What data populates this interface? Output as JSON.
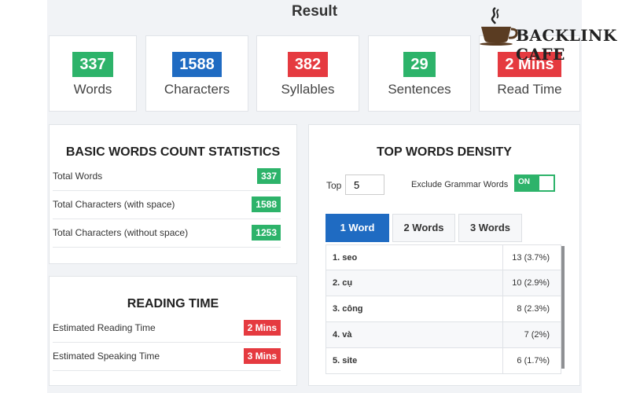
{
  "result_title": "Result",
  "stats": [
    {
      "value": "337",
      "label": "Words",
      "color": "#2db36a"
    },
    {
      "value": "1588",
      "label": "Characters",
      "color": "#1f6bc2"
    },
    {
      "value": "382",
      "label": "Syllables",
      "color": "#e53a40"
    },
    {
      "value": "29",
      "label": "Sentences",
      "color": "#2db36a"
    },
    {
      "value": "2 Mins",
      "label": "Read Time",
      "color": "#e53a40"
    }
  ],
  "basic": {
    "title": "BASIC WORDS COUNT STATISTICS",
    "rows": [
      {
        "label": "Total Words",
        "value": "337"
      },
      {
        "label": "Total Characters (with space)",
        "value": "1588"
      },
      {
        "label": "Total Characters (without space)",
        "value": "1253"
      }
    ]
  },
  "reading": {
    "title": "READING TIME",
    "rows": [
      {
        "label": "Estimated Reading Time",
        "value": "2 Mins"
      },
      {
        "label": "Estimated Speaking Time",
        "value": "3 Mins"
      }
    ]
  },
  "density": {
    "title": "TOP WORDS DENSITY",
    "top_label": "Top",
    "top_value": "5",
    "exclude_label": "Exclude Grammar Words",
    "toggle_label": "ON",
    "tabs": [
      "1 Word",
      "2 Words",
      "3 Words"
    ],
    "active_tab": "1 Word",
    "rows": [
      {
        "word": "1. seo",
        "value": "13 (3.7%)"
      },
      {
        "word": "2. cụ",
        "value": "10 (2.9%)"
      },
      {
        "word": "3. công",
        "value": "8 (2.3%)"
      },
      {
        "word": "4. và",
        "value": "7 (2%)"
      },
      {
        "word": "5. site",
        "value": "6 (1.7%)"
      }
    ]
  },
  "logo_text": "BACKLINK CAFE",
  "colors": {
    "green": "#2db36a",
    "blue": "#1f6bc2",
    "red": "#e53a40"
  }
}
